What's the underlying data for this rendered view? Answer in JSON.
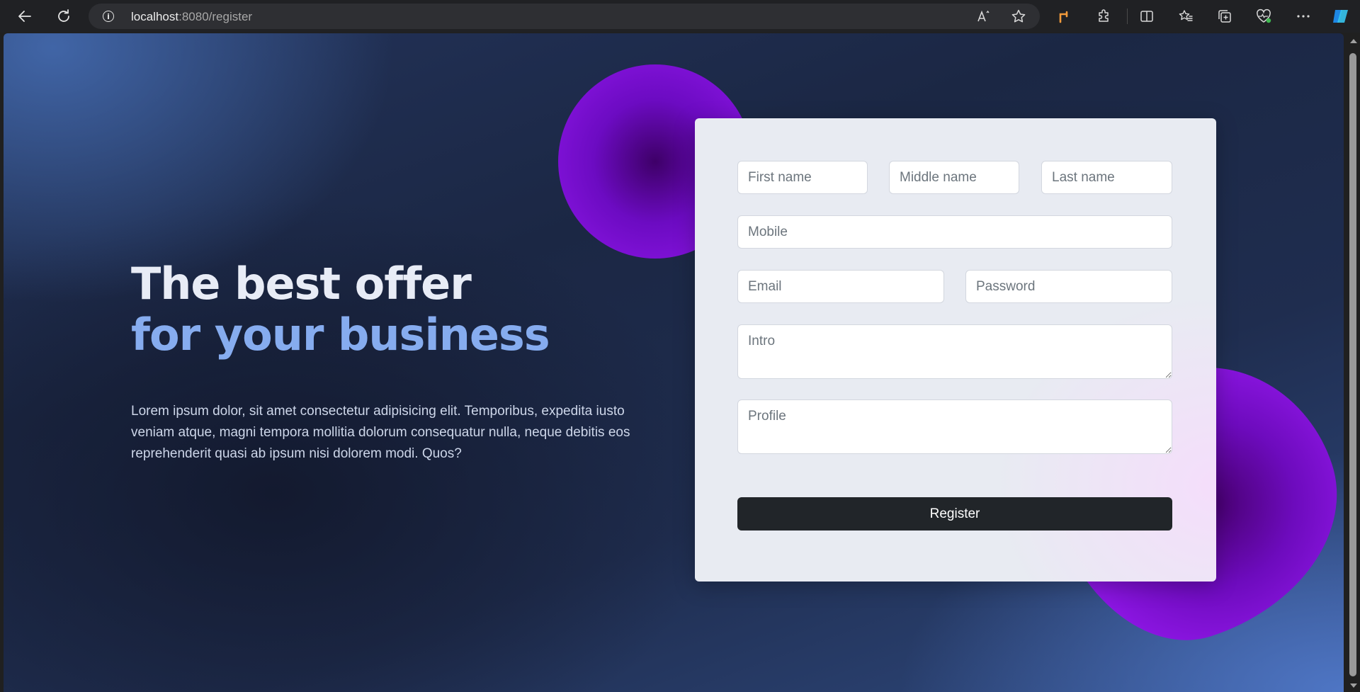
{
  "browser": {
    "url_host": "localhost",
    "url_rest": ":8080/register",
    "info_glyph": "i",
    "icons": {
      "back": "back-arrow-icon",
      "reload": "reload-icon",
      "read_aloud": "read-aloud-icon",
      "favorite": "star-icon",
      "extension_one": "orange-extension-icon",
      "extensions": "puzzle-icon",
      "split_screen": "split-screen-icon",
      "favorites": "favorites-icon",
      "collections": "collections-icon",
      "browser_essentials": "heart-pulse-icon",
      "more": "more-icon",
      "copilot": "copilot-icon"
    }
  },
  "hero": {
    "title_line1": "The best offer",
    "title_line2": "for your business",
    "body": "Lorem ipsum dolor, sit amet consectetur adipisicing elit. Temporibus, expedita iusto veniam atque, magni tempora mollitia dolorum consequatur nulla, neque debitis eos reprehenderit quasi ab ipsum nisi dolorem modi. Quos?"
  },
  "form": {
    "first_name_placeholder": "First name",
    "middle_name_placeholder": "Middle name",
    "last_name_placeholder": "Last name",
    "mobile_placeholder": "Mobile",
    "email_placeholder": "Email",
    "password_placeholder": "Password",
    "intro_placeholder": "Intro",
    "profile_placeholder": "Profile",
    "submit_label": "Register"
  },
  "colors": {
    "accent_title": "#86acef",
    "blob": "#8f17e8",
    "button": "#212529"
  }
}
